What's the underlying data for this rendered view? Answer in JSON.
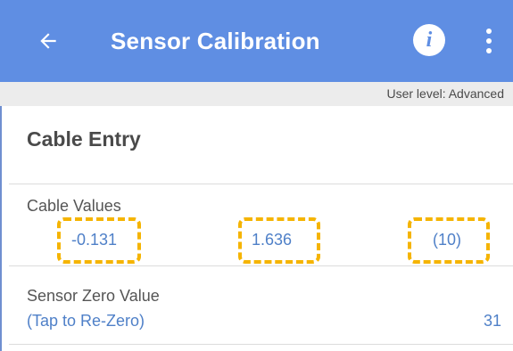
{
  "app_bar": {
    "title": "Sensor Calibration",
    "back_icon": "arrow-left-icon",
    "info_icon": "info-icon",
    "info_glyph": "i",
    "more_icon": "more-vert-icon",
    "color": "#5f8ee3"
  },
  "user_level": {
    "text": "User level: Advanced"
  },
  "section": {
    "title": "Cable Entry"
  },
  "cable_values": {
    "label": "Cable Values",
    "values": [
      "-0.131",
      "1.636",
      "(10)"
    ],
    "highlight_color": "#f5b400"
  },
  "sensor_zero": {
    "label": "Sensor Zero Value",
    "action": "(Tap to Re-Zero)",
    "value": "31"
  }
}
